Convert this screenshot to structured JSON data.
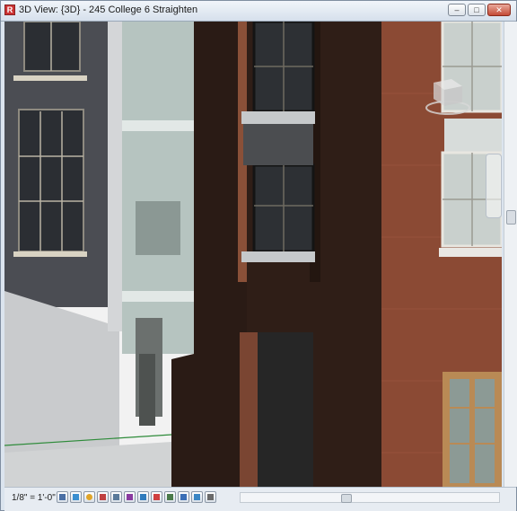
{
  "window": {
    "title": "3D View: {3D} - 245 College 6 Straighten",
    "icon": "revit-app-icon",
    "buttons": {
      "minimize": "–",
      "maximize": "□",
      "close": "✕"
    }
  },
  "status": {
    "scale": "1/8\" = 1'-0\"",
    "controls": [
      "detail-level-icon",
      "visual-style-icon",
      "sun-path-icon",
      "shadows-icon",
      "crop-view-icon",
      "show-crop-icon",
      "temporary-hide-icon",
      "reveal-hidden-icon",
      "lock-view-icon",
      "analysis-icon",
      "highlight-displacement-icon",
      "constraints-icon"
    ]
  },
  "colors": {
    "brick_dark": "#2a1a14",
    "brick_red": "#8a4a33",
    "glass": "#b8c8c4",
    "facade_grey": "#4a4c52",
    "accent": "#c33"
  }
}
